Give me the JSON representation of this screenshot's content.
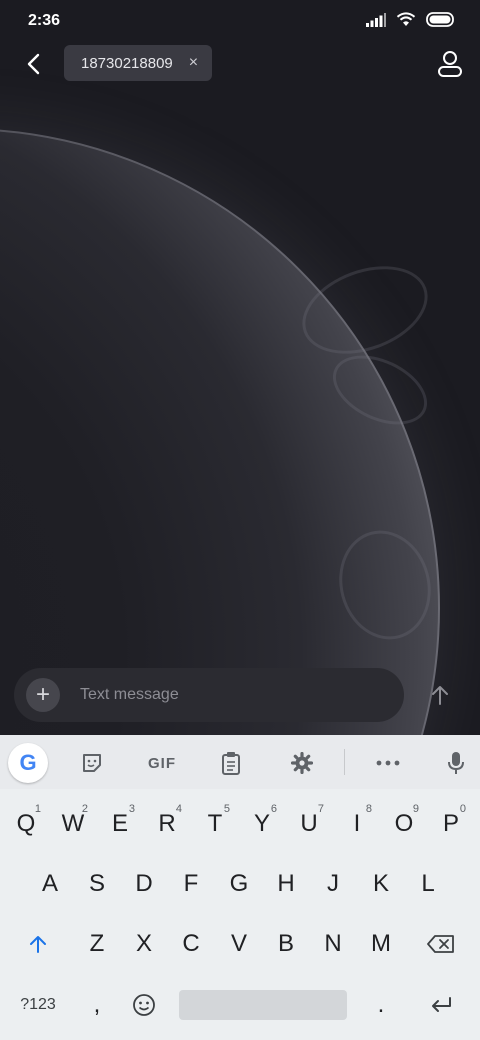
{
  "status": {
    "time": "2:36"
  },
  "topbar": {
    "recipient": "18730218809",
    "chip_close": "×"
  },
  "compose": {
    "placeholder": "Text message",
    "plus": "+"
  },
  "keyboard": {
    "gif_label": "GIF",
    "google_label": "G",
    "row1": [
      {
        "key": "Q",
        "hint": "1"
      },
      {
        "key": "W",
        "hint": "2"
      },
      {
        "key": "E",
        "hint": "3"
      },
      {
        "key": "R",
        "hint": "4"
      },
      {
        "key": "T",
        "hint": "5"
      },
      {
        "key": "Y",
        "hint": "6"
      },
      {
        "key": "U",
        "hint": "7"
      },
      {
        "key": "I",
        "hint": "8"
      },
      {
        "key": "O",
        "hint": "9"
      },
      {
        "key": "P",
        "hint": "0"
      }
    ],
    "row2": [
      "A",
      "S",
      "D",
      "F",
      "G",
      "H",
      "J",
      "K",
      "L"
    ],
    "row3": [
      "Z",
      "X",
      "C",
      "V",
      "B",
      "N",
      "M"
    ],
    "symbols_label": "?123",
    "comma": ",",
    "period": "."
  },
  "colors": {
    "background": "#1b1b21",
    "chip": "#3a3a42",
    "compose": "#2b2b31",
    "keyboard": "#eceff1",
    "shift_accent": "#1a73e8",
    "google_blue": "#4285f4"
  },
  "icons": [
    "back-arrow-icon",
    "contact-icon",
    "plus-icon",
    "send-arrow-icon",
    "google-icon",
    "sticker-icon",
    "gif-icon",
    "clipboard-icon",
    "settings-icon",
    "more-icon",
    "mic-icon",
    "shift-icon",
    "backspace-icon",
    "emoji-icon",
    "enter-icon",
    "signal-icon",
    "wifi-icon",
    "battery-icon"
  ]
}
